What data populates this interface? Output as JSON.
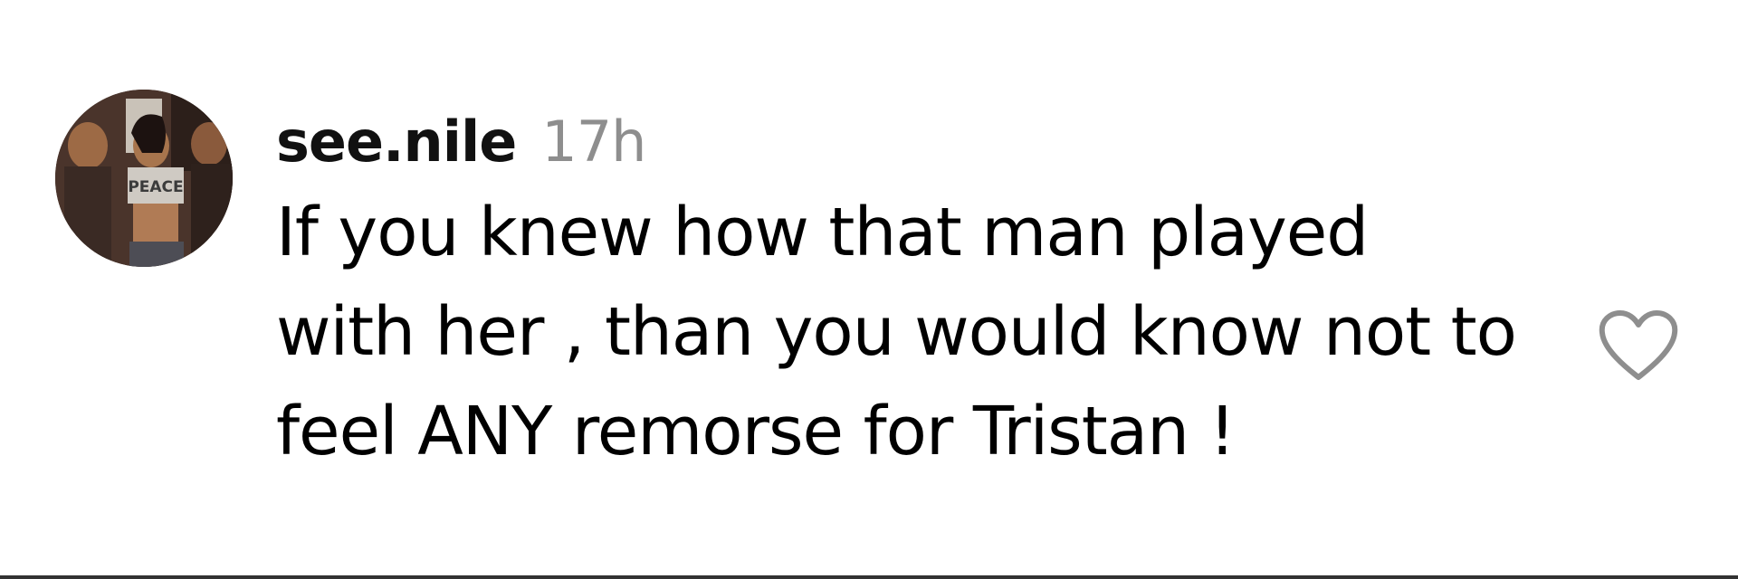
{
  "comment": {
    "username": "see.nile",
    "timestamp": "17h",
    "text": "If you knew how that man played with her , than you would know not to feel ANY remorse for Tristan !",
    "avatar_shirt_text": "PEACE",
    "like_icon": "heart-outline-icon"
  },
  "colors": {
    "text": "#000000",
    "timestamp": "#8e8e8e",
    "icon": "#8e8e8e",
    "divider": "#333333"
  }
}
